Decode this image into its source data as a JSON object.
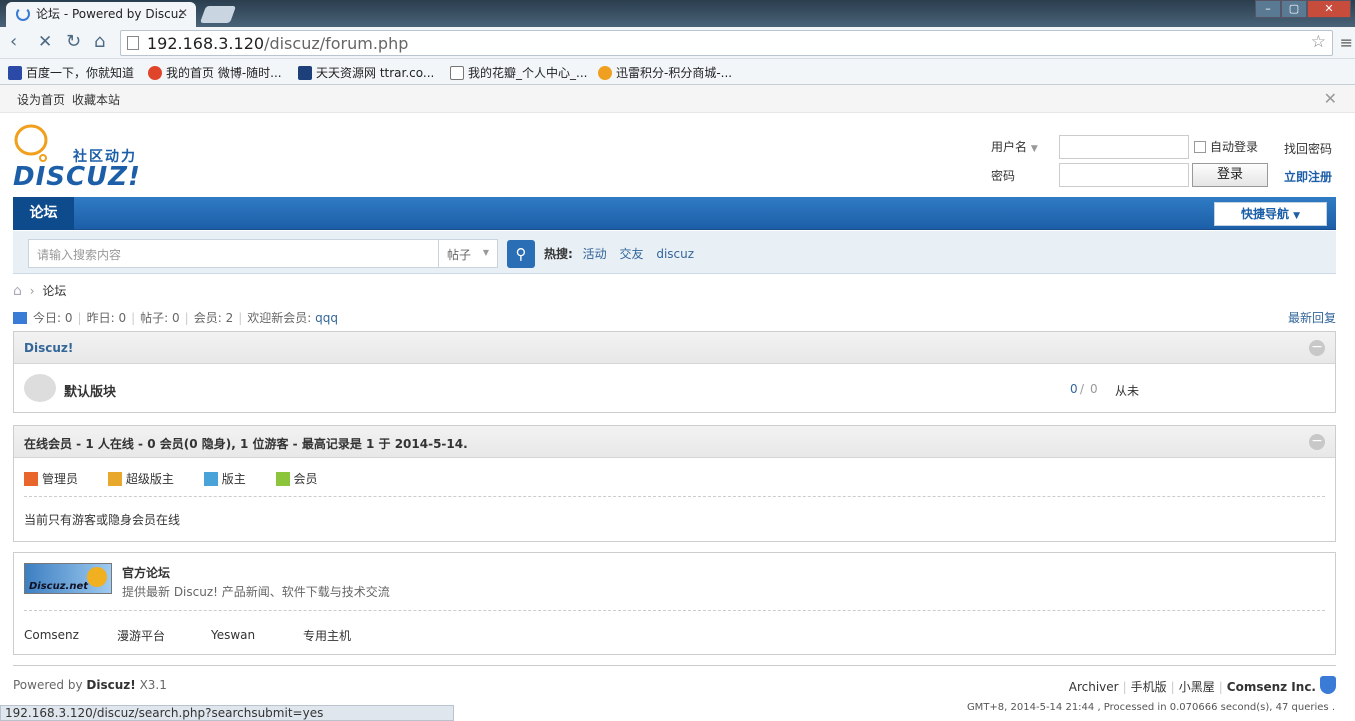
{
  "browser": {
    "tab_title": "论坛 - Powered by Discuz",
    "url_host": "192.168.3.120",
    "url_path": "/discuz/forum.php",
    "bookmarks": [
      "百度一下，你就知道",
      "我的首页 微博-随时...",
      "天天资源网 ttrar.co...",
      "我的花瓣_个人中心_...",
      "迅雷积分-积分商城-..."
    ],
    "status_url": "192.168.3.120/discuz/search.php?searchsubmit=yes"
  },
  "topbar": {
    "set_home": "设为首页",
    "bookmark_site": "收藏本站"
  },
  "logo": {
    "tagline": "社区动力",
    "brand": "DISCUZ!"
  },
  "login": {
    "username_label": "用户名",
    "password_label": "密码",
    "auto_login": "自动登录",
    "login_button": "登录",
    "forgot": "找回密码",
    "register": "立即注册"
  },
  "nav": {
    "current": "论坛",
    "quick": "快捷导航"
  },
  "search": {
    "placeholder": "请输入搜索内容",
    "type": "帖子",
    "hot_label": "热搜:",
    "hot": [
      "活动",
      "交友",
      "discuz"
    ]
  },
  "breadcrumb": {
    "current": "论坛"
  },
  "stats": {
    "today_label": "今日:",
    "today": "0",
    "yesterday_label": "昨日:",
    "yesterday": "0",
    "posts_label": "帖子:",
    "posts": "0",
    "members_label": "会员:",
    "members": "2",
    "welcome_label": "欢迎新会员:",
    "newest_member": "qqq",
    "latest_reply": "最新回复"
  },
  "category": {
    "title": "Discuz!",
    "forum_name": "默认版块",
    "threads": "0",
    "posts": "0",
    "last_post": "从未"
  },
  "online": {
    "title": "在线会员 - 1 人在线 - 0 会员(0 隐身), 1 位游客 - 最高记录是 1 于 2014-5-14.",
    "legend": [
      "管理员",
      "超级版主",
      "版主",
      "会员"
    ],
    "legend_colors": [
      "#e8662c",
      "#e8a82c",
      "#4aa3d8",
      "#8cc43c"
    ],
    "note": "当前只有游客或隐身会员在线"
  },
  "links": {
    "official_name": "官方论坛",
    "official_desc": "提供最新 Discuz! 产品新闻、软件下载与技术交流",
    "badge": "Discuz.net",
    "friends": [
      "Comsenz",
      "漫游平台",
      "Yeswan",
      "专用主机"
    ]
  },
  "footer": {
    "powered_prefix": "Powered by",
    "powered_brand": "Discuz!",
    "version": "X3.1",
    "links": [
      "Archiver",
      "手机版",
      "小黑屋"
    ],
    "company": "Comsenz Inc.",
    "gmt": "GMT+8, 2014-5-14 21:44 , Processed in 0.070666 second(s), 47 queries ."
  }
}
